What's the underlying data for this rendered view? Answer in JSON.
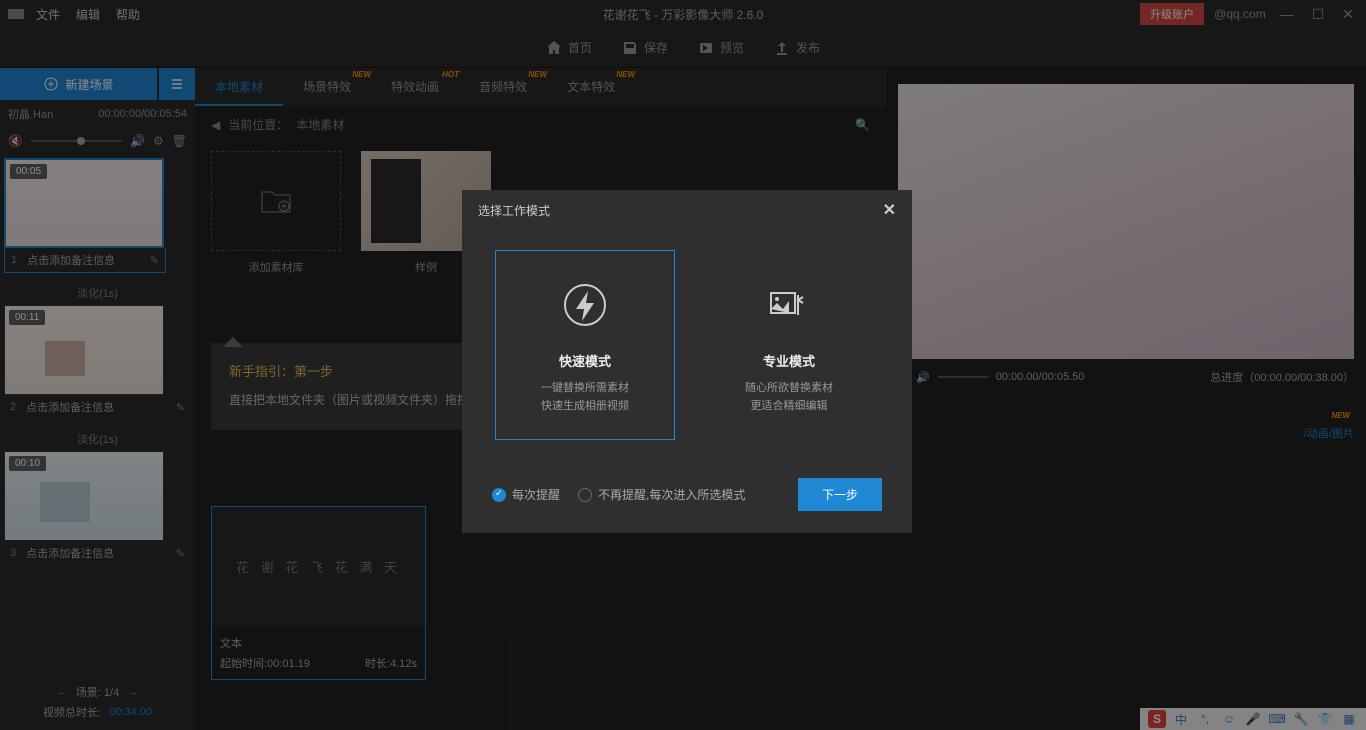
{
  "titlebar": {
    "menus": {
      "file": "文件",
      "edit": "编辑",
      "help": "帮助"
    },
    "title": "花谢花飞 - 万彩影像大师 2.6.0",
    "upgrade": "升级账户",
    "email": "@qq.com"
  },
  "toolbar": {
    "home": "首页",
    "save": "保存",
    "preview": "预览",
    "publish": "发布"
  },
  "sidebar": {
    "newScene": "新建场景",
    "trackName": "初晶.Han",
    "trackTime": "00:00:00/00:05:54",
    "scenes": [
      {
        "badge": "00:05",
        "num": "1",
        "caption": "点击添加备注信息",
        "transition": "淡化(1s)"
      },
      {
        "badge": "00:11",
        "num": "2",
        "caption": "点击添加备注信息",
        "transition": "淡化(1s)"
      },
      {
        "badge": "00:10",
        "num": "3",
        "caption": "点击添加备注信息",
        "transition": ""
      }
    ],
    "footer": {
      "sceneLabel": "场景: 1/4",
      "totalLabel": "视频总时长:",
      "totalTime": "00:34.00"
    }
  },
  "tabs": [
    {
      "label": "本地素材",
      "badge": "",
      "active": true
    },
    {
      "label": "场景特效",
      "badge": "NEW"
    },
    {
      "label": "特效动画",
      "badge": "HOT"
    },
    {
      "label": "音频特效",
      "badge": "NEW"
    },
    {
      "label": "文本特效",
      "badge": "NEW"
    }
  ],
  "breadcrumb": {
    "prefix": "当前位置：",
    "current": "本地素材"
  },
  "assets": {
    "addLib": "添加素材库",
    "sample": "样例"
  },
  "guide": {
    "title": "新手指引：第一步",
    "text": "直接把本地文件夹（图片或视频文件夹）拖拽到当前区域，创建素材库或点击新建文件夹添加……"
  },
  "bottomCard": {
    "previewText": "花 谢 花 飞 花 满 天",
    "label": "文本",
    "startLabel": "起始时间:00:01.19",
    "durLabel": "时长:4.12s"
  },
  "player": {
    "time": "00:00.00/00:05.50",
    "progressLabel": "总进度（00:00.00/00:38.00）",
    "footerLink": "/动画/图片",
    "footerBadge": "NEW"
  },
  "modal": {
    "title": "选择工作模式",
    "fast": {
      "title": "快速模式",
      "desc": "一键替换所需素材\n快速生成相册视频"
    },
    "pro": {
      "title": "专业模式",
      "desc": "随心所欲替换素材\n更适合精细编辑"
    },
    "radio1": "每次提醒",
    "radio2": "不再提醒,每次进入所选模式",
    "next": "下一步"
  },
  "systray": {
    "s": "S",
    "cn": "中"
  }
}
